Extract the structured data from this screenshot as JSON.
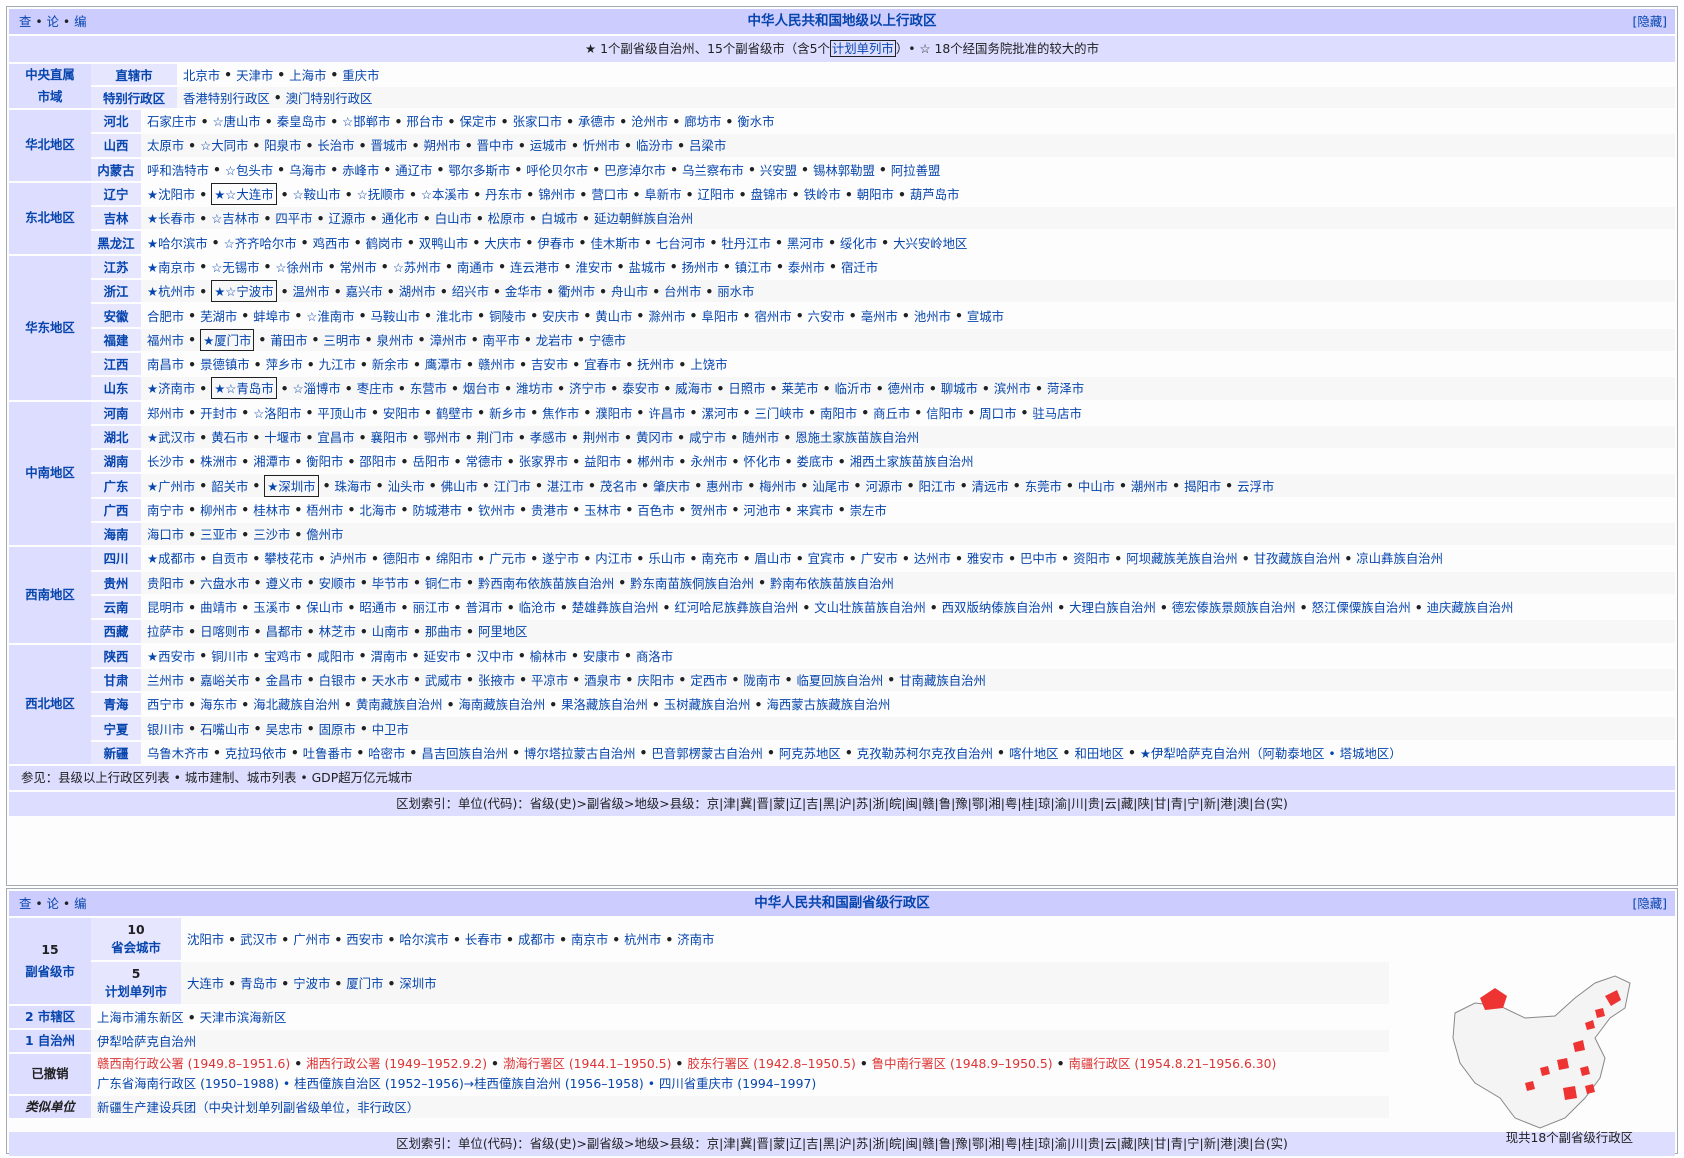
{
  "vte": [
    "查",
    "论",
    "编"
  ],
  "hide": "[隐藏]",
  "nav1": {
    "title": "中华人民共和国地级以上行政区",
    "subtitle": {
      "pre": "★ 1个副省级自治州、15个副省级市（含5个",
      "box": "计划单列市",
      "post": "）• ☆ 18个经国务院批准的较大的市"
    },
    "groups": [
      {
        "name": "中央直属\n市域",
        "rows": [
          {
            "label": "直辖市",
            "items": [
              "北京市",
              "天津市",
              "上海市",
              "重庆市"
            ]
          },
          {
            "label": "特别行政区",
            "items": [
              "香港特别行政区",
              "澳门特别行政区"
            ]
          }
        ]
      },
      {
        "name": "华北地区",
        "rows": [
          {
            "label": "河北",
            "items": [
              "石家庄市",
              "☆唐山市",
              "秦皇岛市",
              "☆邯郸市",
              "邢台市",
              "保定市",
              "张家口市",
              "承德市",
              "沧州市",
              "廊坊市",
              "衡水市"
            ]
          },
          {
            "label": "山西",
            "items": [
              "太原市",
              "☆大同市",
              "阳泉市",
              "长治市",
              "晋城市",
              "朔州市",
              "晋中市",
              "运城市",
              "忻州市",
              "临汾市",
              "吕梁市"
            ]
          },
          {
            "label": "内蒙古",
            "items": [
              "呼和浩特市",
              "☆包头市",
              "乌海市",
              "赤峰市",
              "通辽市",
              "鄂尔多斯市",
              "呼伦贝尔市",
              "巴彦淖尔市",
              "乌兰察布市",
              "兴安盟",
              "锡林郭勒盟",
              "阿拉善盟"
            ]
          }
        ]
      },
      {
        "name": "东北地区",
        "rows": [
          {
            "label": "辽宁",
            "items": [
              "★沈阳市",
              "[★☆大连市]",
              "☆鞍山市",
              "☆抚顺市",
              "☆本溪市",
              "丹东市",
              "锦州市",
              "营口市",
              "阜新市",
              "辽阳市",
              "盘锦市",
              "铁岭市",
              "朝阳市",
              "葫芦岛市"
            ]
          },
          {
            "label": "吉林",
            "items": [
              "★长春市",
              "☆吉林市",
              "四平市",
              "辽源市",
              "通化市",
              "白山市",
              "松原市",
              "白城市",
              "延边朝鲜族自治州"
            ]
          },
          {
            "label": "黑龙江",
            "items": [
              "★哈尔滨市",
              "☆齐齐哈尔市",
              "鸡西市",
              "鹤岗市",
              "双鸭山市",
              "大庆市",
              "伊春市",
              "佳木斯市",
              "七台河市",
              "牡丹江市",
              "黑河市",
              "绥化市",
              "大兴安岭地区"
            ]
          }
        ]
      },
      {
        "name": "华东地区",
        "rows": [
          {
            "label": "江苏",
            "items": [
              "★南京市",
              "☆无锡市",
              "☆徐州市",
              "常州市",
              "☆苏州市",
              "南通市",
              "连云港市",
              "淮安市",
              "盐城市",
              "扬州市",
              "镇江市",
              "泰州市",
              "宿迁市"
            ]
          },
          {
            "label": "浙江",
            "items": [
              "★杭州市",
              "[★☆宁波市]",
              "温州市",
              "嘉兴市",
              "湖州市",
              "绍兴市",
              "金华市",
              "衢州市",
              "舟山市",
              "台州市",
              "丽水市"
            ]
          },
          {
            "label": "安徽",
            "items": [
              "合肥市",
              "芜湖市",
              "蚌埠市",
              "☆淮南市",
              "马鞍山市",
              "淮北市",
              "铜陵市",
              "安庆市",
              "黄山市",
              "滁州市",
              "阜阳市",
              "宿州市",
              "六安市",
              "亳州市",
              "池州市",
              "宣城市"
            ]
          },
          {
            "label": "福建",
            "items": [
              "福州市",
              "[★厦门市]",
              "莆田市",
              "三明市",
              "泉州市",
              "漳州市",
              "南平市",
              "龙岩市",
              "宁德市"
            ]
          },
          {
            "label": "江西",
            "items": [
              "南昌市",
              "景德镇市",
              "萍乡市",
              "九江市",
              "新余市",
              "鹰潭市",
              "赣州市",
              "吉安市",
              "宜春市",
              "抚州市",
              "上饶市"
            ]
          },
          {
            "label": "山东",
            "items": [
              "★济南市",
              "[★☆青岛市]",
              "☆淄博市",
              "枣庄市",
              "东营市",
              "烟台市",
              "潍坊市",
              "济宁市",
              "泰安市",
              "威海市",
              "日照市",
              "莱芜市",
              "临沂市",
              "德州市",
              "聊城市",
              "滨州市",
              "菏泽市"
            ]
          }
        ]
      },
      {
        "name": "中南地区",
        "rows": [
          {
            "label": "河南",
            "items": [
              "郑州市",
              "开封市",
              "☆洛阳市",
              "平顶山市",
              "安阳市",
              "鹤壁市",
              "新乡市",
              "焦作市",
              "濮阳市",
              "许昌市",
              "漯河市",
              "三门峡市",
              "南阳市",
              "商丘市",
              "信阳市",
              "周口市",
              "驻马店市"
            ]
          },
          {
            "label": "湖北",
            "items": [
              "★武汉市",
              "黄石市",
              "十堰市",
              "宜昌市",
              "襄阳市",
              "鄂州市",
              "荆门市",
              "孝感市",
              "荆州市",
              "黄冈市",
              "咸宁市",
              "随州市",
              "恩施土家族苗族自治州"
            ]
          },
          {
            "label": "湖南",
            "items": [
              "长沙市",
              "株洲市",
              "湘潭市",
              "衡阳市",
              "邵阳市",
              "岳阳市",
              "常德市",
              "张家界市",
              "益阳市",
              "郴州市",
              "永州市",
              "怀化市",
              "娄底市",
              "湘西土家族苗族自治州"
            ]
          },
          {
            "label": "广东",
            "items": [
              "★广州市",
              "韶关市",
              "[★深圳市]",
              "珠海市",
              "汕头市",
              "佛山市",
              "江门市",
              "湛江市",
              "茂名市",
              "肇庆市",
              "惠州市",
              "梅州市",
              "汕尾市",
              "河源市",
              "阳江市",
              "清远市",
              "东莞市",
              "中山市",
              "潮州市",
              "揭阳市",
              "云浮市"
            ]
          },
          {
            "label": "广西",
            "items": [
              "南宁市",
              "柳州市",
              "桂林市",
              "梧州市",
              "北海市",
              "防城港市",
              "钦州市",
              "贵港市",
              "玉林市",
              "百色市",
              "贺州市",
              "河池市",
              "来宾市",
              "崇左市"
            ]
          },
          {
            "label": "海南",
            "items": [
              "海口市",
              "三亚市",
              "三沙市",
              "儋州市"
            ]
          }
        ]
      },
      {
        "name": "西南地区",
        "rows": [
          {
            "label": "四川",
            "items": [
              "★成都市",
              "自贡市",
              "攀枝花市",
              "泸州市",
              "德阳市",
              "绵阳市",
              "广元市",
              "遂宁市",
              "内江市",
              "乐山市",
              "南充市",
              "眉山市",
              "宜宾市",
              "广安市",
              "达州市",
              "雅安市",
              "巴中市",
              "资阳市",
              "阿坝藏族羌族自治州",
              "甘孜藏族自治州",
              "凉山彝族自治州"
            ]
          },
          {
            "label": "贵州",
            "items": [
              "贵阳市",
              "六盘水市",
              "遵义市",
              "安顺市",
              "毕节市",
              "铜仁市",
              "黔西南布依族苗族自治州",
              "黔东南苗族侗族自治州",
              "黔南布依族苗族自治州"
            ]
          },
          {
            "label": "云南",
            "items": [
              "昆明市",
              "曲靖市",
              "玉溪市",
              "保山市",
              "昭通市",
              "丽江市",
              "普洱市",
              "临沧市",
              "楚雄彝族自治州",
              "红河哈尼族彝族自治州",
              "文山壮族苗族自治州",
              "西双版纳傣族自治州",
              "大理白族自治州",
              "德宏傣族景颇族自治州",
              "怒江傈僳族自治州",
              "迪庆藏族自治州"
            ]
          },
          {
            "label": "西藏",
            "items": [
              "拉萨市",
              "日喀则市",
              "昌都市",
              "林芝市",
              "山南市",
              "那曲市",
              "阿里地区"
            ]
          }
        ]
      },
      {
        "name": "西北地区",
        "rows": [
          {
            "label": "陕西",
            "items": [
              "★西安市",
              "铜川市",
              "宝鸡市",
              "咸阳市",
              "渭南市",
              "延安市",
              "汉中市",
              "榆林市",
              "安康市",
              "商洛市"
            ]
          },
          {
            "label": "甘肃",
            "items": [
              "兰州市",
              "嘉峪关市",
              "金昌市",
              "白银市",
              "天水市",
              "武威市",
              "张掖市",
              "平凉市",
              "酒泉市",
              "庆阳市",
              "定西市",
              "陇南市",
              "临夏回族自治州",
              "甘南藏族自治州"
            ]
          },
          {
            "label": "青海",
            "items": [
              "西宁市",
              "海东市",
              "海北藏族自治州",
              "黄南藏族自治州",
              "海南藏族自治州",
              "果洛藏族自治州",
              "玉树藏族自治州",
              "海西蒙古族藏族自治州"
            ]
          },
          {
            "label": "宁夏",
            "items": [
              "银川市",
              "石嘴山市",
              "吴忠市",
              "固原市",
              "中卫市"
            ]
          },
          {
            "label": "新疆",
            "items": [
              "乌鲁木齐市",
              "克拉玛依市",
              "吐鲁番市",
              "哈密市",
              "昌吉回族自治州",
              "博尔塔拉蒙古自治州",
              "巴音郭楞蒙古自治州",
              "阿克苏地区",
              "克孜勒苏柯尔克孜自治州",
              "喀什地区",
              "和田地区",
              "★伊犁哈萨克自治州（阿勒泰地区 • 塔城地区）"
            ]
          }
        ]
      }
    ],
    "see_also": "参见：县级以上行政区列表 • 城市建制、城市列表 • GDP超万亿元城市"
  },
  "footer": "区划索引：单位(代码)：省级(史)>副省级>地级>县级：京|津|冀|晋|蒙|辽|吉|黑|沪|苏|浙|皖|闽|赣|鲁|豫|鄂|湘|粤|桂|琼|渝|川|贵|云|藏|陕|甘|青|宁|新|港|澳|台(实)",
  "nav2": {
    "title": "中华人民共和国副省级行政区",
    "sub_count": "15",
    "sub_label": "副省级市",
    "capital_count": "10",
    "capital_label": "省会城市",
    "capital_items": [
      "沈阳市",
      "武汉市",
      "广州市",
      "西安市",
      "哈尔滨市",
      "长春市",
      "成都市",
      "南京市",
      "杭州市",
      "济南市"
    ],
    "plan_count": "5",
    "plan_label": "计划单列市",
    "plan_items": [
      "大连市",
      "青岛市",
      "宁波市",
      "厦门市",
      "深圳市"
    ],
    "district_label": "2 市辖区",
    "district_items": [
      "上海市浦东新区",
      "天津市滨海新区"
    ],
    "pref_label": "1 自治州",
    "pref_items": [
      "伊犁哈萨克自治州"
    ],
    "abolished_label": "已撤销",
    "abolished_line1": [
      "赣西南行政公署 (1949.8–1951.6)",
      "湘西行政公署 (1949–1952.9.2)",
      "渤海行署区 (1944.1–1950.5)",
      "胶东行署区 (1942.8–1950.5)",
      "鲁中南行署区 (1948.9–1950.5)",
      "南疆行政区 (1954.8.21–1956.6.30)"
    ],
    "abolished_line2": "广东省海南行政区 (1950–1988) • 桂西僮族自治区 (1952–1956)→桂西僮族自治州 (1956–1958) • 四川省重庆市 (1994–1997)",
    "similar_label": "类似单位",
    "similar_text": "新疆生产建设兵团（中央计划单列副省级单位，非行政区）",
    "map_caption": "现共18个副省级行政区"
  },
  "colors": {
    "title_bg": "#ccccff",
    "group_bg": "#ddddff",
    "row_bg": "#e6e6ff",
    "link": "#0645ad",
    "redlink": "#dd3333"
  }
}
